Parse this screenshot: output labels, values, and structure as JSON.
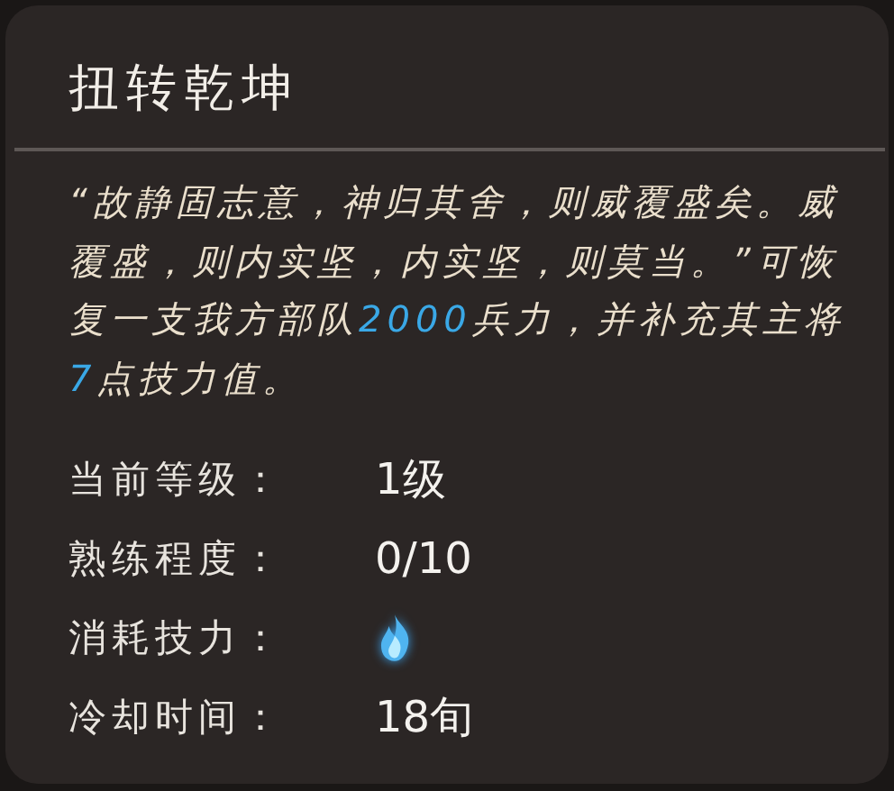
{
  "tooltip": {
    "title": "扭转乾坤",
    "description": [
      {
        "text": "“故静固志意，神归其舍，则威覆盛矣。威覆盛，则内实坚，内实坚，则莫当。”可恢复一支我方部队",
        "highlight": false
      },
      {
        "text": "2000",
        "highlight": true
      },
      {
        "text": "兵力，并补充其主将",
        "highlight": false
      },
      {
        "text": "7",
        "highlight": true
      },
      {
        "text": "点技力值。",
        "highlight": false
      }
    ],
    "stats": [
      {
        "label": "当前等级：",
        "kind": "text",
        "value": "1级"
      },
      {
        "label": "熟练程度：",
        "kind": "text",
        "value": "0/10"
      },
      {
        "label": "消耗技力：",
        "kind": "icon"
      },
      {
        "label": "冷却时间：",
        "kind": "text",
        "value": "18旬"
      }
    ]
  }
}
